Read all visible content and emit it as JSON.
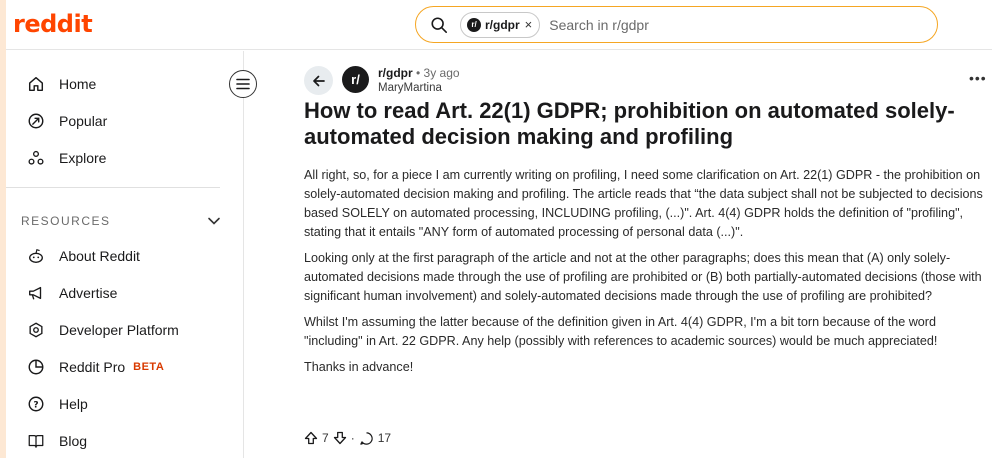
{
  "header": {
    "logo": "reddit",
    "search": {
      "chip_label": "r/gdpr",
      "chip_close": "×",
      "placeholder": "Search in r/gdpr"
    }
  },
  "sidebar": {
    "nav": [
      {
        "label": "Home",
        "icon": "home-icon"
      },
      {
        "label": "Popular",
        "icon": "popular-icon"
      },
      {
        "label": "Explore",
        "icon": "explore-icon"
      }
    ],
    "resources_heading": "RESOURCES",
    "resources": [
      {
        "label": "About Reddit",
        "icon": "reddit-alien-icon"
      },
      {
        "label": "Advertise",
        "icon": "megaphone-icon"
      },
      {
        "label": "Developer Platform",
        "icon": "developer-icon"
      },
      {
        "label": "Reddit Pro",
        "badge": "BETA",
        "icon": "pro-icon"
      },
      {
        "label": "Help",
        "icon": "help-icon"
      },
      {
        "label": "Blog",
        "icon": "blog-icon"
      }
    ]
  },
  "post": {
    "subreddit": "r/gdpr",
    "age": "• 3y ago",
    "author": "MaryMartina",
    "more": "•••",
    "title": "How to read Art. 22(1) GDPR; prohibition on automated solely-automated decision making and profiling",
    "paragraphs": [
      "All right, so, for a piece I am currently writing on profiling, I need some clarification on Art. 22(1) GDPR - the prohibition on solely-automated decision making and profiling. The article reads that “the data subject shall not be subjected to decisions based SOLELY on automated processing, INCLUDING profiling, (...)\". Art. 4(4) GDPR holds the definition of \"profiling\", stating that it entails \"ANY form of automated processing of personal data (...)\".",
      "Looking only at the first paragraph of the article and not at the other paragraphs; does this mean that (A) only solely-automated decisions made through the use of profiling are prohibited or (B) both partially-automated decisions (those with significant human involvement) and solely-automated decisions made through the use of profiling are prohibited?",
      "Whilst I'm assuming the latter because of the definition given in Art. 4(4) GDPR, I'm a bit torn because of the word \"including\" in Art. 22 GDPR. Any help (possibly with references to academic sources) would be much appreciated!",
      "Thanks in advance!"
    ],
    "votes": "7",
    "separator": "·",
    "comments": "17"
  },
  "colors": {
    "brand": "#ff4500",
    "search_border": "#f5a623",
    "beta": "#d93a00",
    "page_backdrop": "#fde8d4"
  }
}
